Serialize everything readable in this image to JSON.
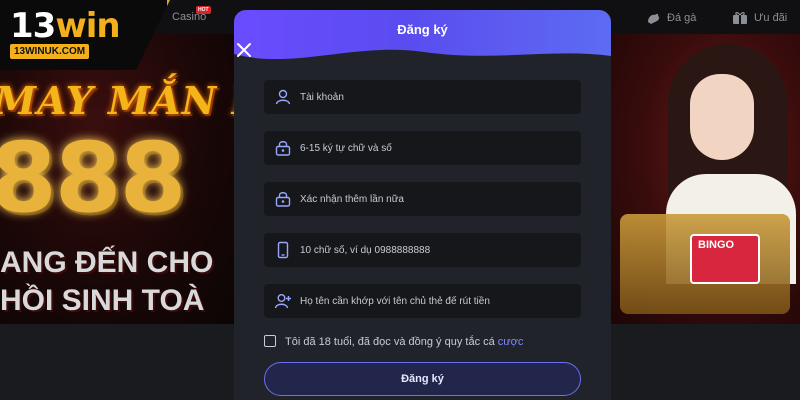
{
  "nav": {
    "casino_label": "Casino",
    "hot_badge": "HOT",
    "daga_label": "Đá gà",
    "uudai_label": "Ưu đãi"
  },
  "logo": {
    "main_prefix": "13",
    "main_suffix": "win",
    "domain": "13WINUK.COM"
  },
  "banner": {
    "line_title": "MAY MẮN K",
    "line_number": "888",
    "line_1": "ANG ĐẾN CHO",
    "line_2": "HỒI SINH TOÀ",
    "bingo_label": "BINGO"
  },
  "modal": {
    "title": "Đăng ký",
    "fields": [
      {
        "placeholder": "Tài khoản",
        "icon": "user-icon"
      },
      {
        "placeholder": "6-15 ký tự chữ và số",
        "icon": "lock-icon"
      },
      {
        "placeholder": "Xác nhận thêm lần nữa",
        "icon": "lock-icon"
      },
      {
        "placeholder": "10 chữ số, ví dụ 0988888888",
        "icon": "phone-icon"
      },
      {
        "placeholder": "Họ tên cần khớp với tên chủ thẻ để rút tiền",
        "icon": "user-add-icon"
      }
    ],
    "agreement_text": "Tôi đã 18 tuổi, đã đọc và đồng ý quy tắc cá",
    "agreement_link": "cược",
    "submit_label": "Đăng ký"
  },
  "colors": {
    "header_gradient_start": "#6a4cff",
    "header_gradient_end": "#5d6bf2",
    "modal_bg": "#20232a",
    "field_bg": "#15171b",
    "accent_link": "#7c8bff",
    "logo_gold": "#f3b01c"
  }
}
